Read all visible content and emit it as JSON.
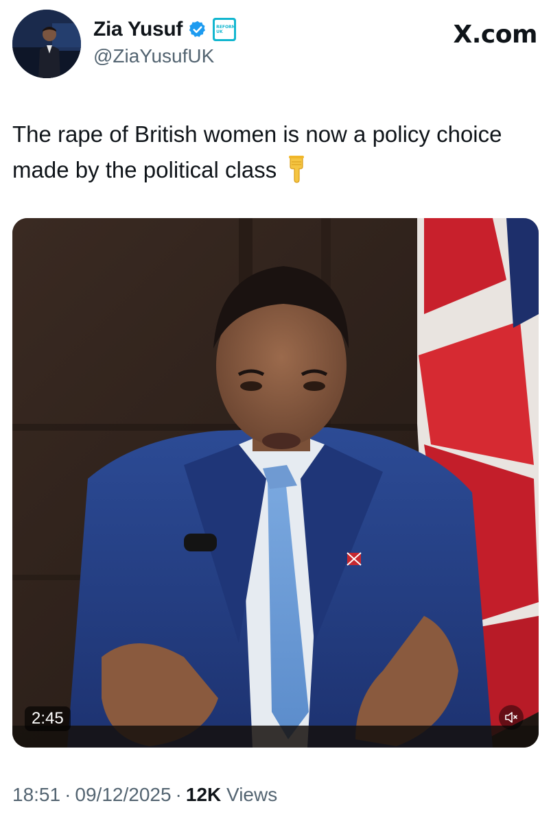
{
  "author": {
    "display_name": "Zia Yusuf",
    "handle": "@ZiaYusufUK",
    "avatar_icon": "avatar-photo",
    "verified_icon": "verified-badge-icon",
    "affiliation_badge_text": "REFORM UK",
    "verified_color": "#1d9bf0"
  },
  "site_label": "X.com",
  "tweet": {
    "text": "The rape of British women is now a policy choice made by the political class",
    "emoji": "backhand-index-pointing-down"
  },
  "video": {
    "duration": "2:45",
    "mute_icon": "speaker-muted-icon"
  },
  "meta": {
    "time": "18:51",
    "separator": "·",
    "date": "09/12/2025",
    "views_count": "12K",
    "views_label": "Views"
  }
}
